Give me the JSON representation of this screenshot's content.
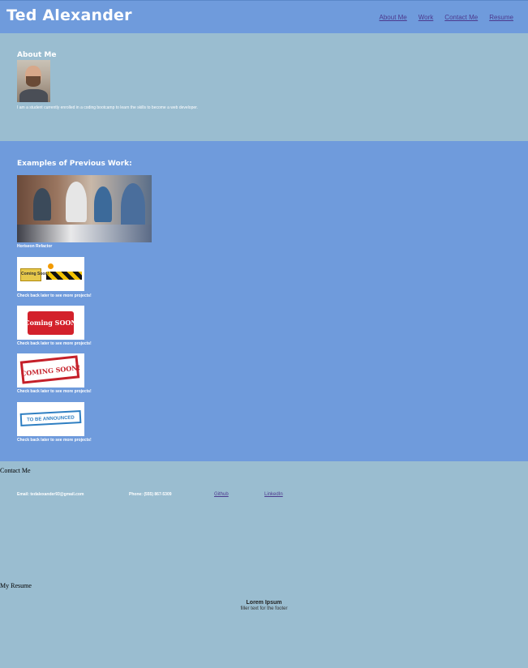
{
  "header": {
    "title": "Ted Alexander",
    "nav": [
      "About Me",
      "Work",
      "Contact Me",
      "Resume"
    ]
  },
  "about": {
    "heading": "About Me",
    "bio": "I am a student currently enrolled in a coding bootcamp to learn the skills to become a web developer."
  },
  "work": {
    "heading": "Examples of Previous Work:",
    "projects": [
      {
        "caption": "Horiseon Refactor",
        "image": "team-meeting-photo"
      },
      {
        "caption": "Check back later to see more projects!",
        "image": "coming-soon-construction",
        "image_text": "Coming Soon!"
      },
      {
        "caption": "Check back later to see more projects!",
        "image": "coming-soon-sign",
        "image_text": "Coming SOON"
      },
      {
        "caption": "Check back later to see more projects!",
        "image": "coming-soon-stamp",
        "image_text": "COMING SOON!"
      },
      {
        "caption": "Check back later to see more projects!",
        "image": "to-be-announced-stamp",
        "image_text": "TO BE ANNOUNCED"
      }
    ]
  },
  "contact": {
    "heading": "Contact Me",
    "email": "Email: tedalexander93@gmail.com",
    "phone": "Phone: (555) 867-5309",
    "github": "Github",
    "linkedin": "LinkedIn"
  },
  "resume": {
    "heading": "My Resume"
  },
  "footer": {
    "title": "Lorem Ipsum",
    "text": "filler text for the footer"
  },
  "colors": {
    "page_bg": "#9abdd0",
    "header_bg": "#6f9bdc",
    "work_bg": "#6f9bdc",
    "link": "#4d3a8e"
  }
}
